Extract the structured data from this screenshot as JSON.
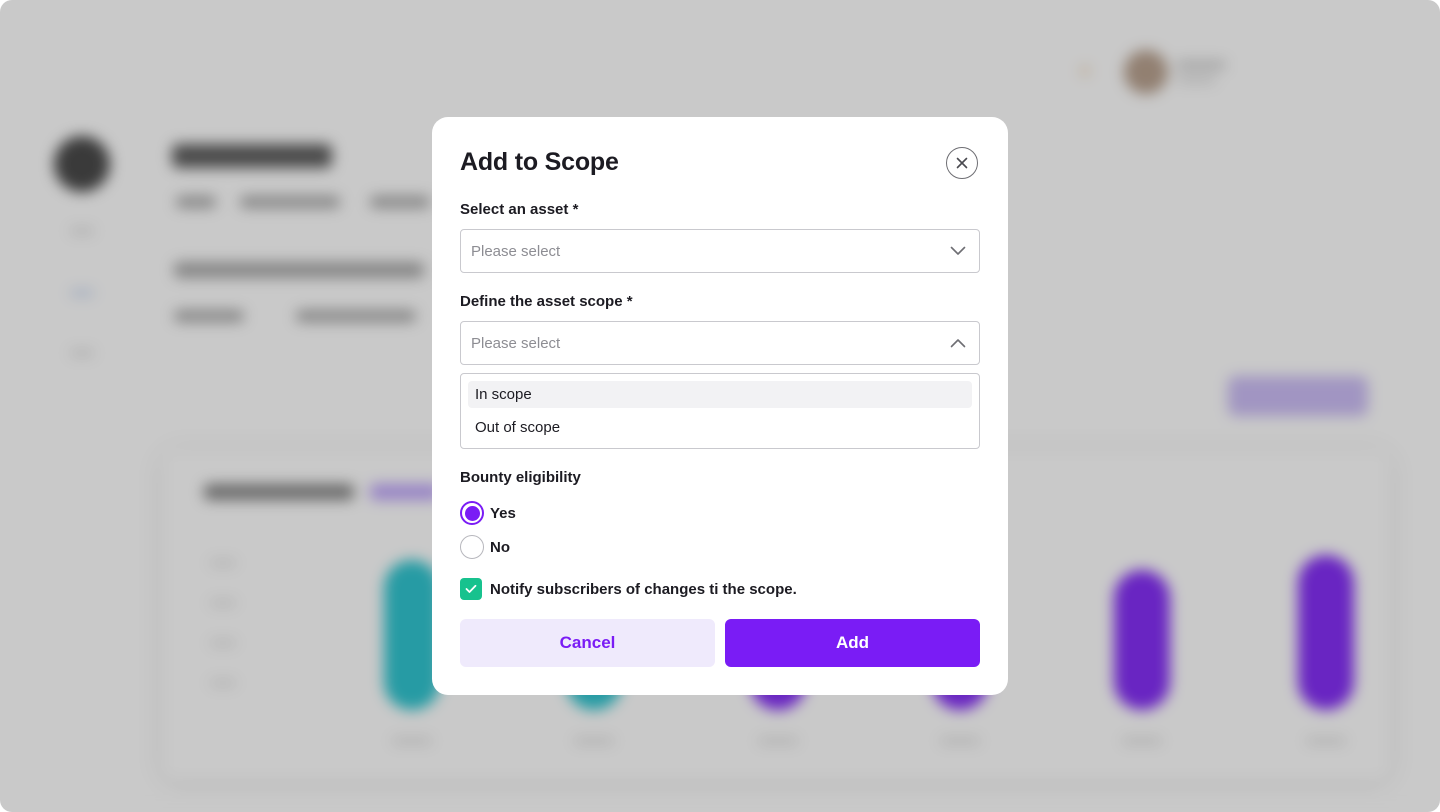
{
  "modal": {
    "title": "Add to Scope",
    "asset_field": {
      "label": "Select an asset *",
      "placeholder": "Please select"
    },
    "scope_field": {
      "label": "Define the asset scope *",
      "placeholder": "Please select",
      "expanded": true,
      "options": [
        {
          "label": "In scope",
          "highlighted": true
        },
        {
          "label": "Out of scope",
          "highlighted": false
        }
      ]
    },
    "bounty": {
      "label": "Bounty eligibility",
      "options": [
        {
          "label": "Yes",
          "selected": true
        },
        {
          "label": "No",
          "selected": false
        }
      ]
    },
    "notify": {
      "label": "Notify subscribers of changes ti the scope.",
      "checked": true
    },
    "cancel_label": "Cancel",
    "add_label": "Add"
  },
  "icons": {
    "close": "close-icon",
    "chevron_down": "chevron-down-icon",
    "chevron_up": "chevron-up-icon",
    "check": "check-icon"
  },
  "colors": {
    "accent": "#7a1cf5",
    "accent_soft": "#efeafc",
    "success": "#17c28e",
    "teal": "#1ec0cc"
  }
}
